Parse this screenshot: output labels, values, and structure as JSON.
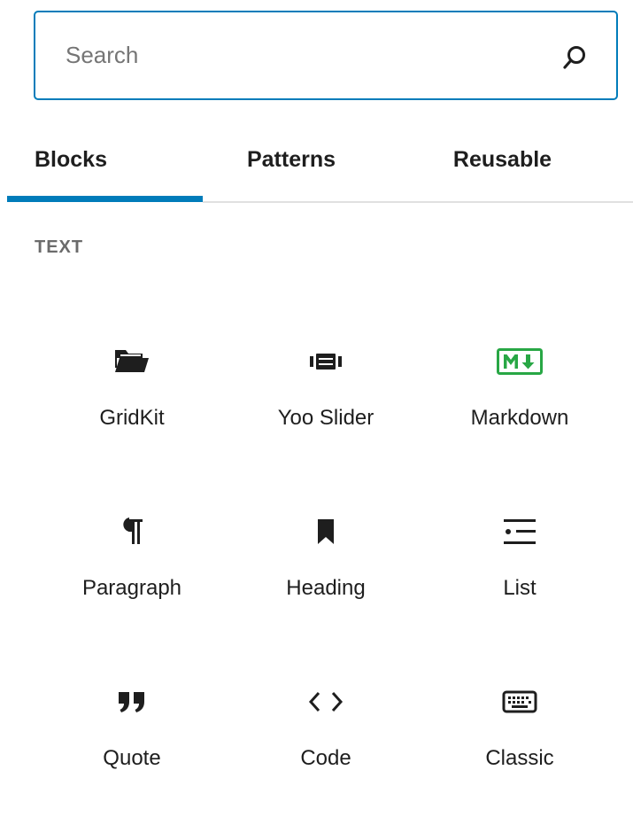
{
  "search": {
    "placeholder": "Search",
    "value": "",
    "icon": "search-icon",
    "border_color": "#007cba"
  },
  "tabs": [
    {
      "label": "Blocks",
      "active": true
    },
    {
      "label": "Patterns",
      "active": false
    },
    {
      "label": "Reusable",
      "active": false
    }
  ],
  "accent_color": "#007cba",
  "category": {
    "title": "TEXT"
  },
  "blocks": [
    {
      "label": "GridKit",
      "icon": "folder-icon"
    },
    {
      "label": "Yoo Slider",
      "icon": "slider-icon"
    },
    {
      "label": "Markdown",
      "icon": "markdown-icon",
      "icon_color": "#28a745"
    },
    {
      "label": "Paragraph",
      "icon": "paragraph-icon"
    },
    {
      "label": "Heading",
      "icon": "bookmark-icon"
    },
    {
      "label": "List",
      "icon": "list-icon"
    },
    {
      "label": "Quote",
      "icon": "quote-icon"
    },
    {
      "label": "Code",
      "icon": "code-icon"
    },
    {
      "label": "Classic",
      "icon": "keyboard-icon"
    }
  ]
}
